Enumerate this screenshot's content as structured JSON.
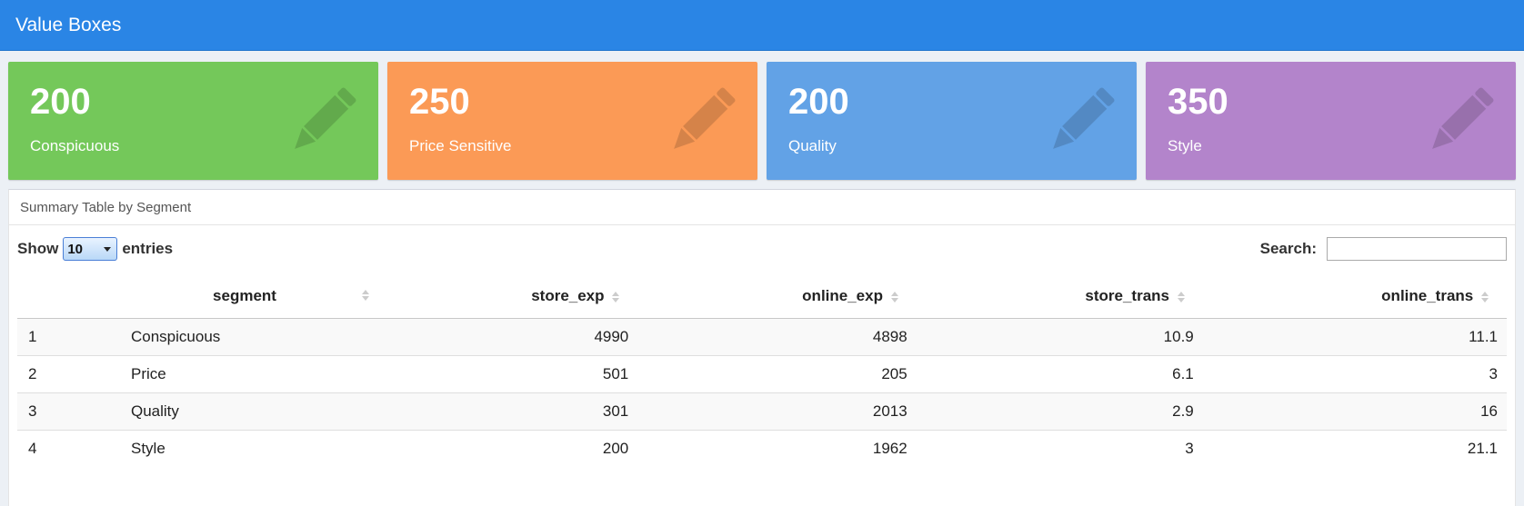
{
  "header": {
    "title": "Value Boxes"
  },
  "value_boxes": [
    {
      "value": "200",
      "label": "Conspicuous",
      "color": "#74c85a",
      "icon": "pencil-icon"
    },
    {
      "value": "250",
      "label": "Price Sensitive",
      "color": "#fb9a56",
      "icon": "pencil-icon"
    },
    {
      "value": "200",
      "label": "Quality",
      "color": "#62a2e6",
      "icon": "pencil-icon"
    },
    {
      "value": "350",
      "label": "Style",
      "color": "#b384cb",
      "icon": "pencil-icon"
    }
  ],
  "panel": {
    "title": "Summary Table by Segment"
  },
  "controls": {
    "show_label": "Show",
    "entries_value": "10",
    "entries_label": "entries",
    "search_label": "Search:",
    "search_value": ""
  },
  "table": {
    "columns": [
      "",
      "segment",
      "store_exp",
      "online_exp",
      "store_trans",
      "online_trans"
    ],
    "rows": [
      [
        "1",
        "Conspicuous",
        "4990",
        "4898",
        "10.9",
        "11.1"
      ],
      [
        "2",
        "Price",
        "501",
        "205",
        "6.1",
        "3"
      ],
      [
        "3",
        "Quality",
        "301",
        "2013",
        "2.9",
        "16"
      ],
      [
        "4",
        "Style",
        "200",
        "1962",
        "3",
        "21.1"
      ]
    ]
  }
}
